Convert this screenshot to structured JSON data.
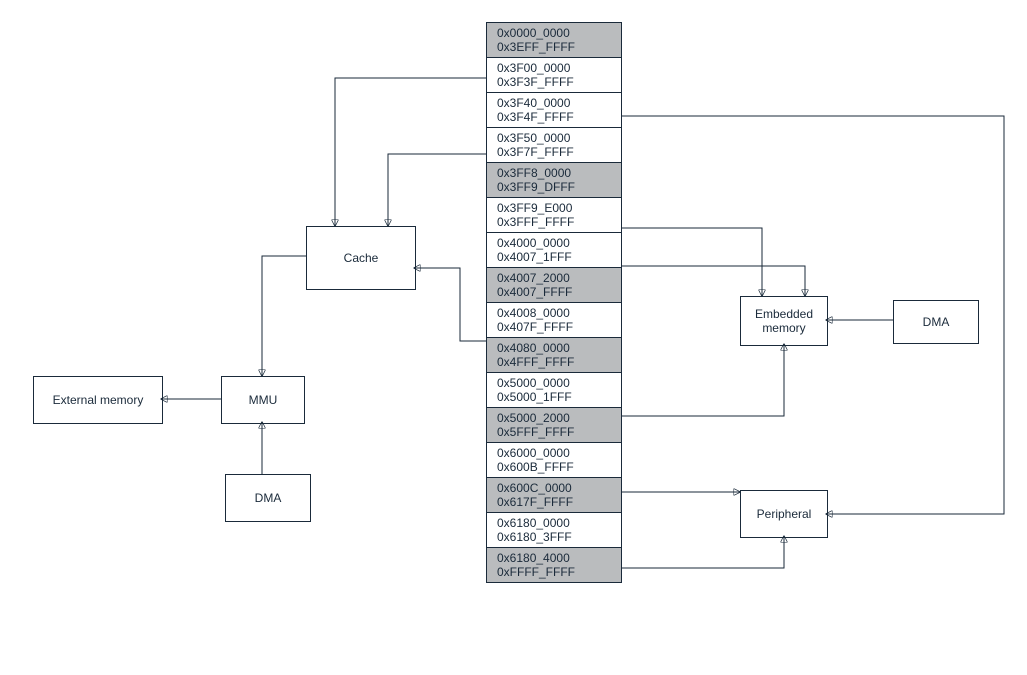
{
  "diagram": {
    "addr_map": [
      {
        "start": "0x0000_0000",
        "end": "0x3EFF_FFFF",
        "shaded": true
      },
      {
        "start": "0x3F00_0000",
        "end": "0x3F3F_FFFF",
        "shaded": false
      },
      {
        "start": "0x3F40_0000",
        "end": "0x3F4F_FFFF",
        "shaded": false
      },
      {
        "start": "0x3F50_0000",
        "end": "0x3F7F_FFFF",
        "shaded": false
      },
      {
        "start": "0x3FF8_0000",
        "end": "0x3FF9_DFFF",
        "shaded": true
      },
      {
        "start": "0x3FF9_E000",
        "end": "0x3FFF_FFFF",
        "shaded": false
      },
      {
        "start": "0x4000_0000",
        "end": "0x4007_1FFF",
        "shaded": false
      },
      {
        "start": "0x4007_2000",
        "end": "0x4007_FFFF",
        "shaded": true
      },
      {
        "start": "0x4008_0000",
        "end": "0x407F_FFFF",
        "shaded": false
      },
      {
        "start": "0x4080_0000",
        "end": "0x4FFF_FFFF",
        "shaded": true
      },
      {
        "start": "0x5000_0000",
        "end": "0x5000_1FFF",
        "shaded": false
      },
      {
        "start": "0x5000_2000",
        "end": "0x5FFF_FFFF",
        "shaded": true
      },
      {
        "start": "0x6000_0000",
        "end": "0x600B_FFFF",
        "shaded": false
      },
      {
        "start": "0x600C_0000",
        "end": "0x617F_FFFF",
        "shaded": true
      },
      {
        "start": "0x6180_0000",
        "end": "0x6180_3FFF",
        "shaded": false
      },
      {
        "start": "0x6180_4000",
        "end": "0xFFFF_FFFF",
        "shaded": true
      }
    ],
    "blocks": {
      "external_memory": "External memory",
      "mmu": "MMU",
      "cache": "Cache",
      "dma_left": "DMA",
      "embedded_memory": "Embedded\nmemory",
      "dma_right": "DMA",
      "peripheral": "Peripheral"
    }
  }
}
